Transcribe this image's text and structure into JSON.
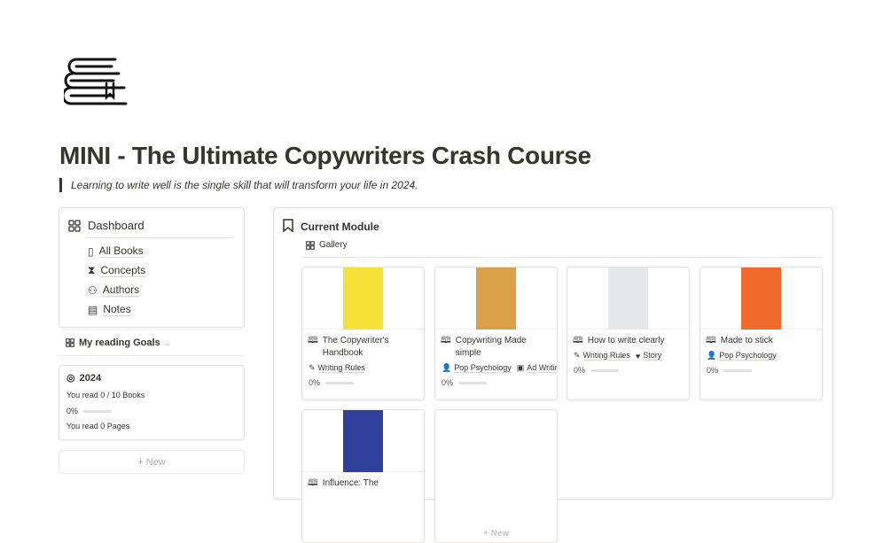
{
  "page": {
    "title": "MINI - The Ultimate Copywriters Crash Course",
    "quote": "Learning to write well is the single skill that will transform your life in 2024.",
    "icon": "books-stack-icon"
  },
  "dashboard": {
    "title": "Dashboard",
    "items": [
      {
        "label": "All Books",
        "icon": "book-icon"
      },
      {
        "label": "Concepts",
        "icon": "dna-icon"
      },
      {
        "label": "Authors",
        "icon": "people-icon"
      },
      {
        "label": "Notes",
        "icon": "notes-icon"
      }
    ]
  },
  "goals": {
    "view_label": "My reading Goals",
    "card": {
      "year": "2024",
      "books_read": "You read 0 / 10 Books",
      "progress_label": "0%",
      "progress": 0,
      "pages_read": "You read 0 Pages"
    },
    "new_label": "+ New"
  },
  "module": {
    "title": "Current Module",
    "view_label": "Gallery",
    "new_label": "+ New",
    "cards": [
      {
        "title": "The Copywriter's Handbook",
        "cover_color": "#f6e13a",
        "tags": [
          {
            "icon": "pencil-icon",
            "label": "Writing Rules"
          }
        ],
        "progress_label": "0%",
        "progress": 0
      },
      {
        "title": "Copywriting Made simple",
        "cover_color": "#d9a24a",
        "tags": [
          {
            "icon": "person-icon",
            "label": "Pop Psychology"
          },
          {
            "icon": "image-icon",
            "label": "Ad Writing"
          }
        ],
        "progress_label": "0%",
        "progress": 0
      },
      {
        "title": "How to write clearly",
        "cover_color": "#e6e8ea",
        "tags": [
          {
            "icon": "pencil-icon",
            "label": "Writing Rules"
          },
          {
            "icon": "heart-icon",
            "label": "Story"
          }
        ],
        "progress_label": "0%",
        "progress": 0
      },
      {
        "title": "Made to stick",
        "cover_color": "#ef6a2b",
        "tags": [
          {
            "icon": "person-icon",
            "label": "Pop Psychology"
          }
        ],
        "progress_label": "0%",
        "progress": 0
      },
      {
        "title": "Influence: The",
        "cover_color": "#2f3f9a",
        "tags": [],
        "progress_label": "",
        "progress": 0
      }
    ]
  }
}
